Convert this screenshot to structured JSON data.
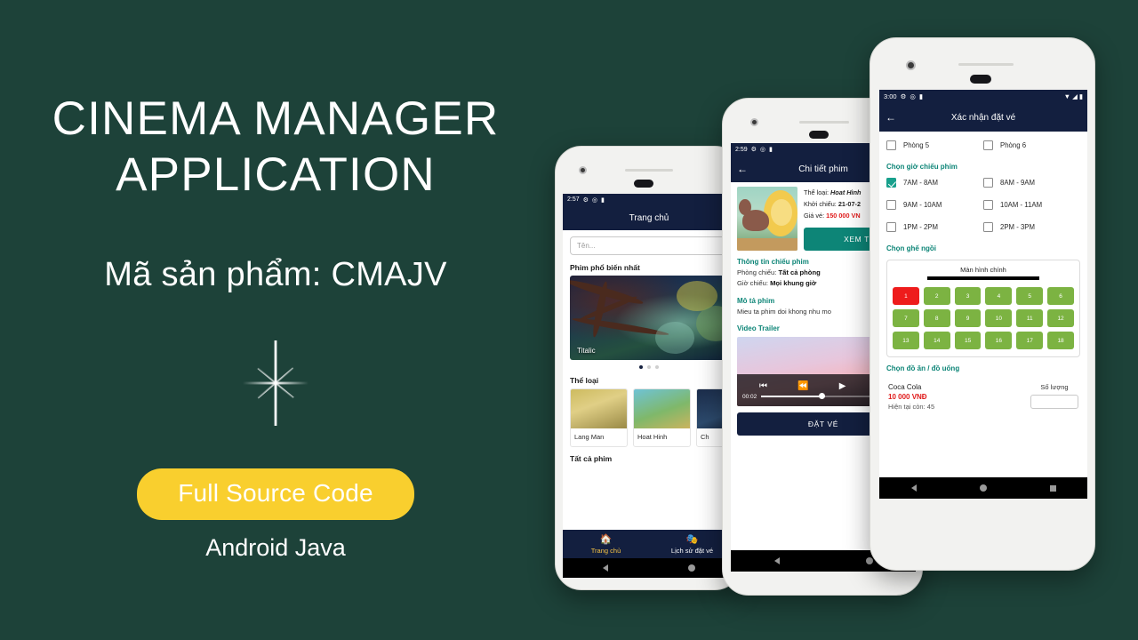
{
  "promo": {
    "title_line1": "CINEMA MANAGER",
    "title_line2": "APPLICATION",
    "subtitle": "Mã sản phẩm: CMAJV",
    "cta_label": "Full Source Code",
    "cta_sub": "Android Java",
    "bg_color": "#1d4239",
    "accent_yellow": "#f9cf2e"
  },
  "phone1": {
    "status": {
      "time": "2:57",
      "icons": [
        "gear-icon",
        "location-icon",
        "battery-icon"
      ]
    },
    "appbar": {
      "title": "Trang chủ"
    },
    "search": {
      "placeholder": "Tên..."
    },
    "section_popular": "Phim phổ biến nhất",
    "hero": {
      "label": "Titalic"
    },
    "carousel_dots": 3,
    "section_genre": "Thể loại",
    "genres": [
      {
        "name": "Lang Man"
      },
      {
        "name": "Hoat Hinh"
      },
      {
        "name": "Ch"
      }
    ],
    "section_all": "Tất cả phim",
    "bottom_nav": [
      {
        "label": "Trang chủ",
        "icon": "home-icon",
        "active": true
      },
      {
        "label": "Lịch sử đặt vé",
        "icon": "ticket-history-icon",
        "active": false
      }
    ]
  },
  "phone2": {
    "status": {
      "time": "2:59",
      "icons": [
        "gear-icon",
        "location-icon",
        "battery-icon"
      ]
    },
    "appbar": {
      "title": "Chi tiết phim",
      "back": "←"
    },
    "meta": {
      "genre_label": "Thể loại:",
      "genre_value": "Hoat Hình",
      "release_label": "Khởi chiếu:",
      "release_value": "21-07-2",
      "price_label": "Giá vé:",
      "price_value": "150 000 VN"
    },
    "btn_view": "XEM T",
    "section_info": "Thông tin chiếu phim",
    "info_rows": [
      {
        "k": "Phòng chiếu:",
        "v": "Tất cả phòng"
      },
      {
        "k": "Giờ chiếu:",
        "v": "Mọi khung giờ"
      }
    ],
    "section_desc": "Mô tả phim",
    "desc_text": "Mieu ta phim doi khong nhu mo",
    "section_trailer": "Video Trailer",
    "player": {
      "time": "00:02",
      "progress": 42
    },
    "btn_book": "ĐẶT VÉ"
  },
  "phone3": {
    "status": {
      "time": "3:00",
      "icons": [
        "gear-icon",
        "location-icon",
        "battery-icon"
      ],
      "right_icons": [
        "wifi-icon",
        "signal-icon",
        "battery-icon"
      ]
    },
    "appbar": {
      "title": "Xác nhận đặt vé",
      "back": "←"
    },
    "rooms": [
      {
        "label": "Phòng 5",
        "checked": false
      },
      {
        "label": "Phòng 6",
        "checked": false
      }
    ],
    "section_time": "Chọn giờ chiếu phim",
    "showtimes": [
      {
        "label": "7AM - 8AM",
        "checked": true
      },
      {
        "label": "8AM - 9AM",
        "checked": false
      },
      {
        "label": "9AM - 10AM",
        "checked": false
      },
      {
        "label": "10AM - 11AM",
        "checked": false
      },
      {
        "label": "1PM - 2PM",
        "checked": false
      },
      {
        "label": "2PM - 3PM",
        "checked": false
      }
    ],
    "section_seat": "Chọn ghế ngồi",
    "screen_label": "Màn hình chính",
    "seats": [
      [
        {
          "n": "1",
          "taken": true
        },
        {
          "n": "2",
          "taken": false
        },
        {
          "n": "3",
          "taken": false
        },
        {
          "n": "4",
          "taken": false
        },
        {
          "n": "5",
          "taken": false
        },
        {
          "n": "6",
          "taken": false
        }
      ],
      [
        {
          "n": "7",
          "taken": false
        },
        {
          "n": "8",
          "taken": false
        },
        {
          "n": "9",
          "taken": false
        },
        {
          "n": "10",
          "taken": false
        },
        {
          "n": "11",
          "taken": false
        },
        {
          "n": "12",
          "taken": false
        }
      ],
      [
        {
          "n": "13",
          "taken": false
        },
        {
          "n": "14",
          "taken": false
        },
        {
          "n": "15",
          "taken": false
        },
        {
          "n": "16",
          "taken": false
        },
        {
          "n": "17",
          "taken": false
        },
        {
          "n": "18",
          "taken": false
        }
      ]
    ],
    "seat_colors": {
      "available": "#7cb342",
      "taken": "#ee1c1c"
    },
    "section_food": "Chọn đồ ăn / đồ uống",
    "food": {
      "name": "Coca Cola",
      "price": "10 000 VNĐ",
      "stock": "Hiện tại còn: 45",
      "qty_label": "Số lượng",
      "qty_value": ""
    }
  }
}
